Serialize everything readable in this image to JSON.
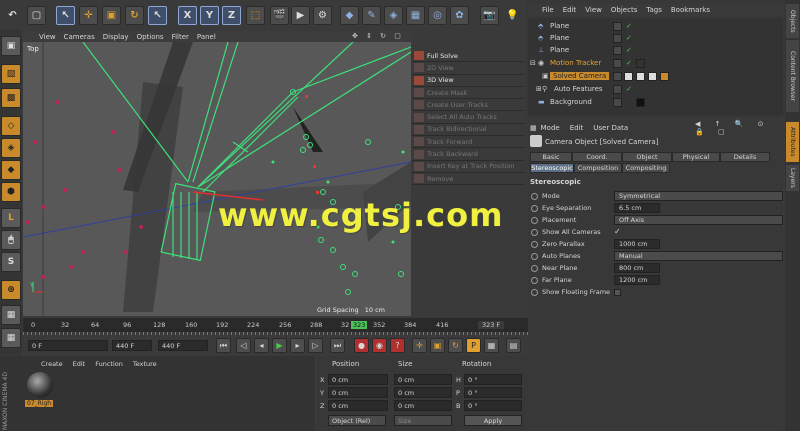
{
  "toolbar": {
    "axis_x": "X",
    "axis_y": "Y",
    "axis_z": "Z"
  },
  "viewport": {
    "view_label": "Top",
    "menu": [
      "View",
      "Cameras",
      "Display",
      "Options",
      "Filter",
      "Panel"
    ],
    "grid_spacing": "Grid Spacing   10 cm",
    "axis_y": "Y",
    "axis_x": "X"
  },
  "watermark": "www.cgtsj.com",
  "tracker": {
    "full_solve": "Full Solve",
    "view_2d": "2D View",
    "view_3d": "3D View",
    "create_mask": "Create Mask",
    "create_user_tracks": "Create User Tracks",
    "select_all_auto": "Select All Auto Tracks",
    "track_bidirectional": "Track Bidirectional",
    "track_forward": "Track Forward",
    "track_backward": "Track Backward",
    "insert_key": "Insert Key at Track Position",
    "remove": "Remove"
  },
  "objects": {
    "menu": [
      "File",
      "Edit",
      "View",
      "Objects",
      "Tags",
      "Bookmarks"
    ],
    "rows": [
      {
        "name": "Plane"
      },
      {
        "name": "Plane"
      },
      {
        "name": "Plane"
      },
      {
        "name": "Motion Tracker"
      },
      {
        "name": "Solved Camera"
      },
      {
        "name": "Auto Features"
      },
      {
        "name": "Background"
      }
    ]
  },
  "attributes": {
    "menu": [
      "Mode",
      "Edit",
      "User Data"
    ],
    "title": "Camera Object [Solved Camera]",
    "tabs_row1": [
      "Basic",
      "Coord.",
      "Object",
      "Physical",
      "Details"
    ],
    "tabs_row2": [
      "Stereoscopic",
      "Composition",
      "Compositing"
    ],
    "section": "Stereoscopic",
    "props": [
      {
        "label": "Mode",
        "value": "Symmetrical"
      },
      {
        "label": "Eye Separation",
        "value": "6.5 cm"
      },
      {
        "label": "Placement",
        "value": "Off Axis"
      },
      {
        "label": "Show All Cameras",
        "value": "✓"
      },
      {
        "label": "Zero Parallax",
        "value": "1000 cm"
      },
      {
        "label": "Auto Planes",
        "value": "Manual"
      },
      {
        "label": "Near Plane",
        "value": "800 cm"
      },
      {
        "label": "Far Plane",
        "value": "1200 cm"
      },
      {
        "label": "Show Floating Frame",
        "value": ""
      }
    ]
  },
  "right_tabs": [
    "Objects",
    "Content Browser",
    "Attributes",
    "Layers"
  ],
  "timeline": {
    "ticks": [
      "0",
      "32",
      "64",
      "96",
      "128",
      "160",
      "192",
      "224",
      "256",
      "288",
      "32",
      "323",
      "352",
      "384",
      "416"
    ],
    "end_frame": "323 F",
    "current": "0 F",
    "range_end": "440 F",
    "range_end2": "440 F"
  },
  "materials": {
    "menu": [
      "Create",
      "Edit",
      "Function",
      "Texture"
    ],
    "mat_name": "07_Righ"
  },
  "coords": {
    "headers": [
      "Position",
      "Size",
      "Rotation"
    ],
    "rows": [
      {
        "axis": "X",
        "pos": "0 cm",
        "size": "0 cm",
        "rot_axis": "H",
        "rot": "0 °"
      },
      {
        "axis": "Y",
        "pos": "0 cm",
        "size": "0 cm",
        "rot_axis": "P",
        "rot": "0 °"
      },
      {
        "axis": "Z",
        "pos": "0 cm",
        "size": "0 cm",
        "rot_axis": "B",
        "rot": "0 °"
      }
    ],
    "mode": "Object (Rel)",
    "size_mode": "Size",
    "apply": "Apply"
  },
  "brand": "MAXON CINEMA 4D"
}
